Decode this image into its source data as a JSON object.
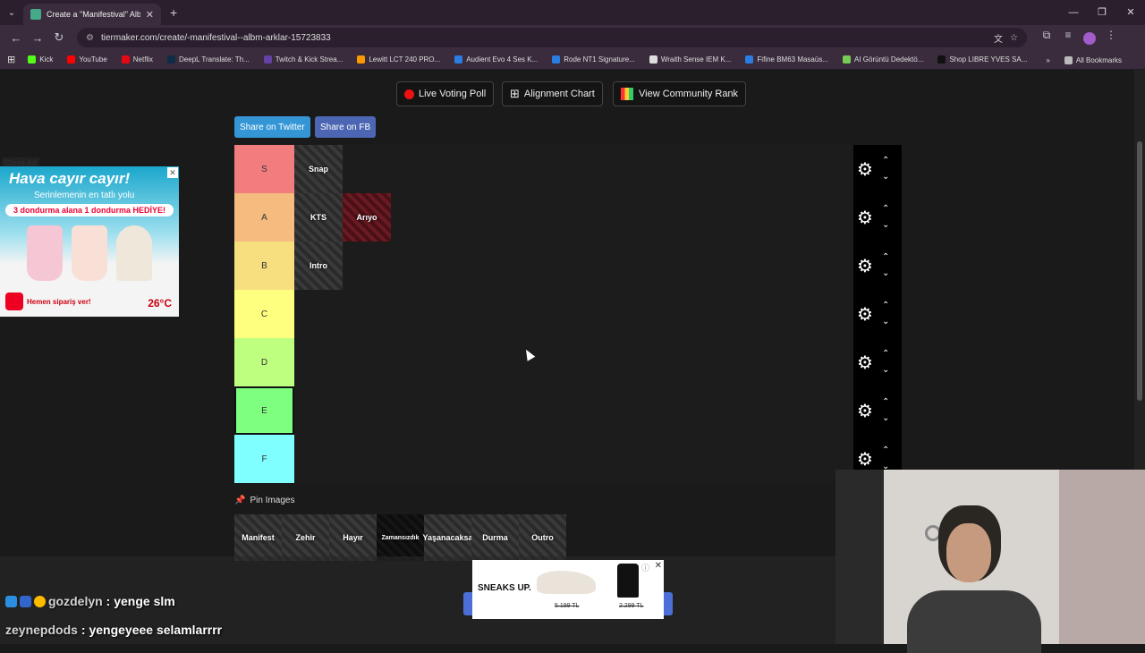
{
  "browser": {
    "tab_title": "Create a \"Manifestival\" Albüm Ş",
    "url": "tiermaker.com/create/-manifestival--albm-arklar-15723833",
    "bookmarks": [
      "Kick",
      "YouTube",
      "Netflix",
      "DeepL Translate: Th...",
      "Twitch & Kick Strea...",
      "Lewitt LCT 240 PRO...",
      "Audient Evo 4 Ses K...",
      "Rode NT1 Signature...",
      "Wraith Sense IEM K...",
      "Fifine BM63 Masaüs...",
      "AI Görüntü Dedektö...",
      "Shop LIBRE YVES SA..."
    ],
    "all_bookmarks": "All Bookmarks"
  },
  "toolbar": {
    "live_voting": "Live Voting Poll",
    "alignment": "Alignment Chart",
    "community": "View Community Rank",
    "share_twitter": "Share on Twitter",
    "share_fb": "Share on FB"
  },
  "tiers": [
    {
      "label": "S",
      "color": "#f27d7f",
      "items": [
        {
          "name": "Snap",
          "style": "grey"
        }
      ]
    },
    {
      "label": "A",
      "color": "#f5bb7f",
      "items": [
        {
          "name": "KTS",
          "style": "grey"
        },
        {
          "name": "Arıyo",
          "style": "red"
        }
      ]
    },
    {
      "label": "B",
      "color": "#f7de7f",
      "items": [
        {
          "name": "Intro",
          "style": "grey"
        }
      ]
    },
    {
      "label": "C",
      "color": "#feff7f",
      "items": []
    },
    {
      "label": "D",
      "color": "#bfff7f",
      "items": []
    },
    {
      "label": "E",
      "color": "#7fff7f",
      "items": []
    },
    {
      "label": "F",
      "color": "#7fffff",
      "items": []
    }
  ],
  "pin_label": "Pin Images",
  "pool": [
    {
      "name": "Manifest",
      "style": "grey"
    },
    {
      "name": "Zehir",
      "style": "grey"
    },
    {
      "name": "Hayır",
      "style": "grey"
    },
    {
      "name": "Zamansızdık",
      "style": "dark"
    },
    {
      "name": "Yaşanacaksa",
      "style": "grey"
    },
    {
      "name": "Durma",
      "style": "grey"
    },
    {
      "name": "Outro",
      "style": "grey"
    }
  ],
  "ad_left": {
    "headline": "Hava cayır cayır!",
    "sub": "Serinlemenin en tatlı yolu",
    "promo": "3 dondurma alana 1 dondurma HEDİYE!",
    "order": "Hemen sipariş ver!",
    "temp": "26°C",
    "close": "Close Ad"
  },
  "ad_bottom": {
    "brand": "SNEAKS UP.",
    "price1": "5.199 TL",
    "price2": "2.299 TL"
  },
  "chat": [
    {
      "user": "gozdelyn",
      "msg": ": yenge slm"
    },
    {
      "user": "zeynepdods",
      "msg": ": yengeyeee selamlarrrr"
    }
  ]
}
